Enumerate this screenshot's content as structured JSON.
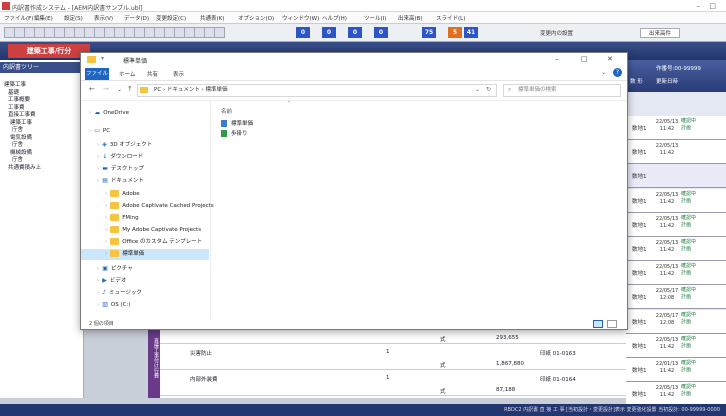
{
  "app": {
    "title": "内訳書作成システム - [AEM内訳書サンプル.ubl]",
    "menu": [
      "ファイル(F)",
      "編集(E)",
      "設定(S)",
      "表示(V)",
      "データ(D)",
      "変更設定(C)",
      "共通表(K)",
      "オプション(O)",
      "ウィンドウ(W)",
      "ヘルプ(H)",
      "ツール(I)",
      "出来高(B)",
      "スライド(L)"
    ],
    "toolbar_numbers": [
      "0",
      "0",
      "0",
      "0",
      "75",
      "5",
      "41"
    ],
    "toolbar_labels": {
      "change": "変更内の設置",
      "filter": "出来高件"
    },
    "left_tab": "建築工事/行分",
    "tree_header": "内訳書ツリー",
    "tree_items": [
      "建築工事",
      "基礎",
      "工事概要",
      "工事費",
      "直接工事費",
      "建築工事",
      "庁舎",
      "電気設備",
      "庁舎",
      "機械設備",
      "庁舎",
      "共通費積み上"
    ],
    "right_header": {
      "code": "作番号:00-99999",
      "col_a": "数 形",
      "col_b": "更新日時"
    },
    "right_rows": [
      {
        "a": "数地1",
        "b": "22/05/13 11:42",
        "c": "確認中 計画"
      },
      {
        "a": "数地1",
        "b": "22/05/13 11:42",
        "c": ""
      },
      {
        "a": "数地1",
        "b": "",
        "c": ""
      },
      {
        "a": "数地1",
        "b": "22/05/13 11:42",
        "c": "確認中 計画"
      },
      {
        "a": "数地1",
        "b": "22/05/13 11:42",
        "c": "確認中 計画"
      },
      {
        "a": "数地1",
        "b": "22/05/13 11:42",
        "c": "確認中 計画"
      },
      {
        "a": "数地1",
        "b": "22/05/13 11:42",
        "c": "確認中 計画"
      },
      {
        "a": "数地1",
        "b": "22/05/17 12:08",
        "c": "確認中 計画"
      },
      {
        "a": "数地1",
        "b": "22/05/17 12:08",
        "c": "確認中 計画"
      },
      {
        "a": "数地1",
        "b": "22/05/13 11:42",
        "c": "確認中 計画"
      },
      {
        "a": "数地1",
        "b": "22/01/13 11:42",
        "c": "確認中 計画"
      },
      {
        "a": "数地1",
        "b": "22/05/13 11:42",
        "c": "確認中 計画"
      }
    ],
    "grid_side": "直接工事付け行費",
    "grid_rows": [
      {
        "name": "内部仕上工事",
        "qty": "1",
        "unit": "",
        "price": "",
        "code": "印紙 01-0162"
      },
      {
        "name": "",
        "qty": "",
        "unit": "式",
        "price": "293,655",
        "code": ""
      },
      {
        "name": "災害防止",
        "qty": "1",
        "unit": "",
        "price": "",
        "code": "印紙 01-0163"
      },
      {
        "name": "",
        "qty": "",
        "unit": "式",
        "price": "1,867,880",
        "code": ""
      },
      {
        "name": "内部外装費",
        "qty": "1",
        "unit": "",
        "price": "",
        "code": "印紙 01-0164"
      },
      {
        "name": "",
        "qty": "",
        "unit": "式",
        "price": "87,188",
        "code": ""
      }
    ],
    "statusbar": "RBDC2 内訳書 直 接 工 事  [当初設計・変更設計]表示  変更強化設置  当初設計: 00-99999-0000"
  },
  "explorer": {
    "title": "標準単価",
    "ribbon": {
      "file": "ファイル",
      "home": "ホーム",
      "share": "共有",
      "view": "表示"
    },
    "address": "PC › ドキュメント › 標準単価",
    "search_placeholder": "標準単価の検索",
    "column_name": "名前",
    "nav": [
      {
        "label": "OneDrive",
        "indent": 0,
        "icon": "cloud-icon"
      },
      {
        "label": "PC",
        "indent": 0,
        "icon": "pc-icon"
      },
      {
        "label": "3D オブジェクト",
        "indent": 1,
        "icon": "cube-icon"
      },
      {
        "label": "ダウンロード",
        "indent": 1,
        "icon": "download-icon"
      },
      {
        "label": "デスクトップ",
        "indent": 1,
        "icon": "desktop-icon"
      },
      {
        "label": "ドキュメント",
        "indent": 1,
        "icon": "document-icon"
      },
      {
        "label": "Adobe",
        "indent": 2,
        "icon": "folder-icon"
      },
      {
        "label": "Adobe Captivate Cached Projects",
        "indent": 2,
        "icon": "folder-icon"
      },
      {
        "label": "FMing",
        "indent": 2,
        "icon": "folder-icon"
      },
      {
        "label": "My Adobe Captivate Projects",
        "indent": 2,
        "icon": "folder-icon"
      },
      {
        "label": "Office のカスタム テンプレート",
        "indent": 2,
        "icon": "folder-icon"
      },
      {
        "label": "標準単価",
        "indent": 2,
        "icon": "folder-icon",
        "selected": true
      },
      {
        "label": "ピクチャ",
        "indent": 1,
        "icon": "picture-icon"
      },
      {
        "label": "ビデオ",
        "indent": 1,
        "icon": "video-icon"
      },
      {
        "label": "ミュージック",
        "indent": 1,
        "icon": "music-icon"
      },
      {
        "label": "OS (C:)",
        "indent": 1,
        "icon": "drive-icon"
      }
    ],
    "files": [
      {
        "label": "標準単価",
        "icon": "file-icon"
      },
      {
        "label": "歩掛り",
        "icon": "file-icon"
      }
    ],
    "status": "2 個の項目"
  },
  "colors": {
    "accent": "#1e66c0",
    "ribbon": "#2a3c78",
    "left_tab": "#cc4040",
    "selected": "#cce6fb"
  }
}
